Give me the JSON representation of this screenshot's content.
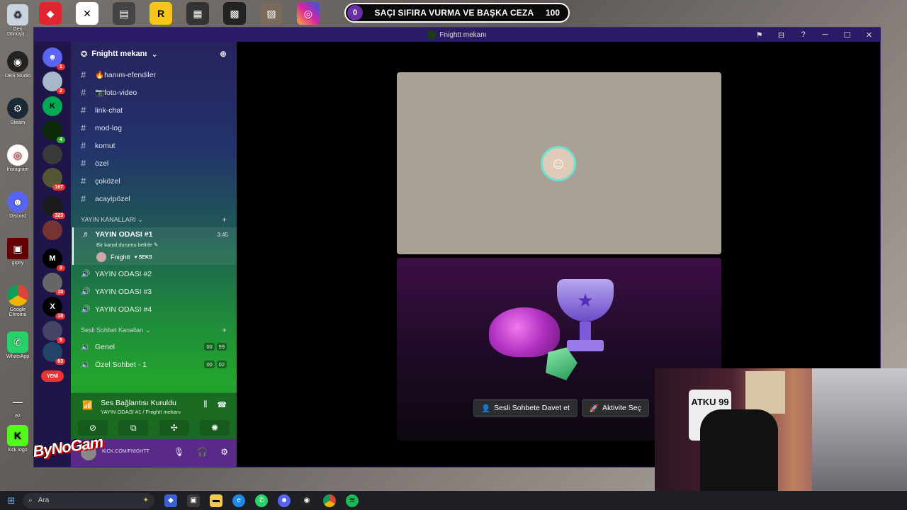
{
  "counter": {
    "left_value": "0",
    "title": "SAÇI SIFIRA VURMA VE BAŞKA CEZA",
    "right_value": "100"
  },
  "desktop_icons": [
    {
      "label": "Geri Dönüşü...",
      "icon": "recycle-bin-icon"
    },
    {
      "label": "OBS Studio",
      "icon": "obs-icon"
    },
    {
      "label": "Steam",
      "icon": "steam-icon"
    },
    {
      "label": "Instagram",
      "icon": "chrome-app-icon"
    },
    {
      "label": "Discord",
      "icon": "discord-icon"
    },
    {
      "label": "giphy",
      "icon": "image-icon"
    },
    {
      "label": "Google Chrome",
      "icon": "chrome-icon"
    },
    {
      "label": "WhatsApp",
      "icon": "whatsapp-icon"
    },
    {
      "label": "ez",
      "icon": "shortcut-icon"
    },
    {
      "label": "kick logo",
      "icon": "kick-icon"
    }
  ],
  "window": {
    "title": "Fnightt mekanı"
  },
  "server": {
    "name": "Fnightt mekanı"
  },
  "text_channels": [
    {
      "name": "🔥hanım-efendiler"
    },
    {
      "name": "📷foto-video"
    },
    {
      "name": "link-chat"
    },
    {
      "name": "mod-log"
    },
    {
      "name": "komut"
    },
    {
      "name": "özel"
    },
    {
      "name": "çoközel"
    },
    {
      "name": "acayipözel"
    }
  ],
  "categories": {
    "stream": "YAYIN KANALLARI",
    "voice": "Sesli Sohbet Kanalları"
  },
  "active_voice": {
    "name": "YAYIN ODASI #1",
    "time": "3:45",
    "status": "Bir kanal durumu belirle",
    "member": "Fnightt",
    "member_tag": "SEKS"
  },
  "stream_channels": [
    {
      "name": "YAYIN ODASI #2"
    },
    {
      "name": "YAYIN ODASI #3"
    },
    {
      "name": "YAYIN ODASI #4"
    }
  ],
  "voice_channels": [
    {
      "name": "Genel",
      "a": "00",
      "b": "99"
    },
    {
      "name": "Özel Sohbet - 1",
      "a": "00",
      "b": "02"
    }
  ],
  "connection": {
    "title": "Ses Bağlantısı Kuruldu",
    "subtitle": "YAYIN ODASI #1 / Fnightt mekanı"
  },
  "user_panel": {
    "status": "KICK.COM/FNIGHTT"
  },
  "overlay_text": "ByNoGam",
  "server_badges": [
    "1",
    "2",
    "",
    "4",
    "167",
    "323",
    "",
    "3",
    "10",
    "18",
    "5",
    "63",
    "4"
  ],
  "new_label": "YENİ",
  "activity_buttons": {
    "invite": "Sesli Sohbete Davet et",
    "activity": "Aktivite Seç"
  },
  "webcam": {
    "shirt_text": "ATKU 99"
  },
  "taskbar": {
    "search_placeholder": "Ara"
  }
}
